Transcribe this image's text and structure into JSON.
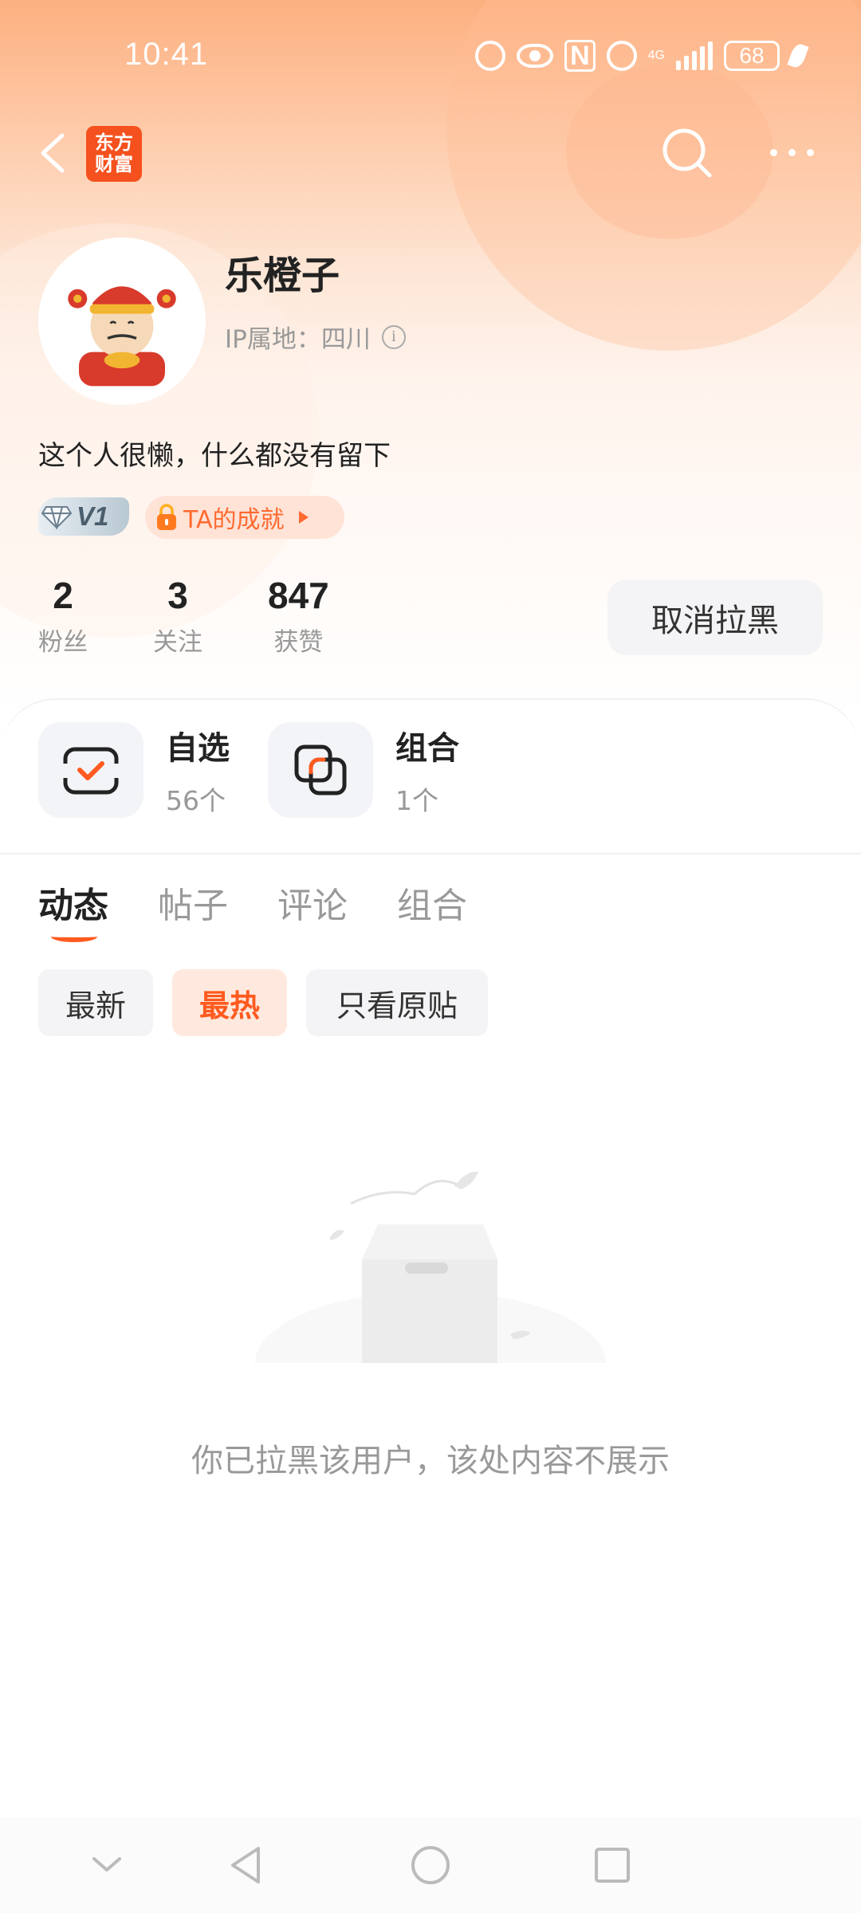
{
  "status_bar": {
    "time": "10:41",
    "network": "4G",
    "battery": "68"
  },
  "nav": {
    "brand_line1": "东方",
    "brand_line2": "财富",
    "icons": [
      "back-arrow-icon",
      "search-icon",
      "more-icon"
    ]
  },
  "profile": {
    "username": "乐橙子",
    "ip_location": "IP属地：四川",
    "bio": "这个人很懒，什么都没有留下",
    "level_badge": "V1",
    "achievement": "TA的成就"
  },
  "stats": [
    {
      "value": "2",
      "label": "粉丝"
    },
    {
      "value": "3",
      "label": "关注"
    },
    {
      "value": "847",
      "label": "获赞"
    }
  ],
  "unblock_button": "取消拉黑",
  "features": [
    {
      "title": "自选",
      "count": "56个"
    },
    {
      "title": "组合",
      "count": "1个"
    }
  ],
  "tabs": [
    "动态",
    "帖子",
    "评论",
    "组合"
  ],
  "active_tab": "动态",
  "filters": [
    "最新",
    "最热",
    "只看原贴"
  ],
  "active_filter": "最热",
  "empty_state": "你已拉黑该用户，该处内容不展示",
  "colors": {
    "accent": "#ff5a1f",
    "brand": "#f4511e",
    "header_gradient_top": "#fdb080"
  }
}
